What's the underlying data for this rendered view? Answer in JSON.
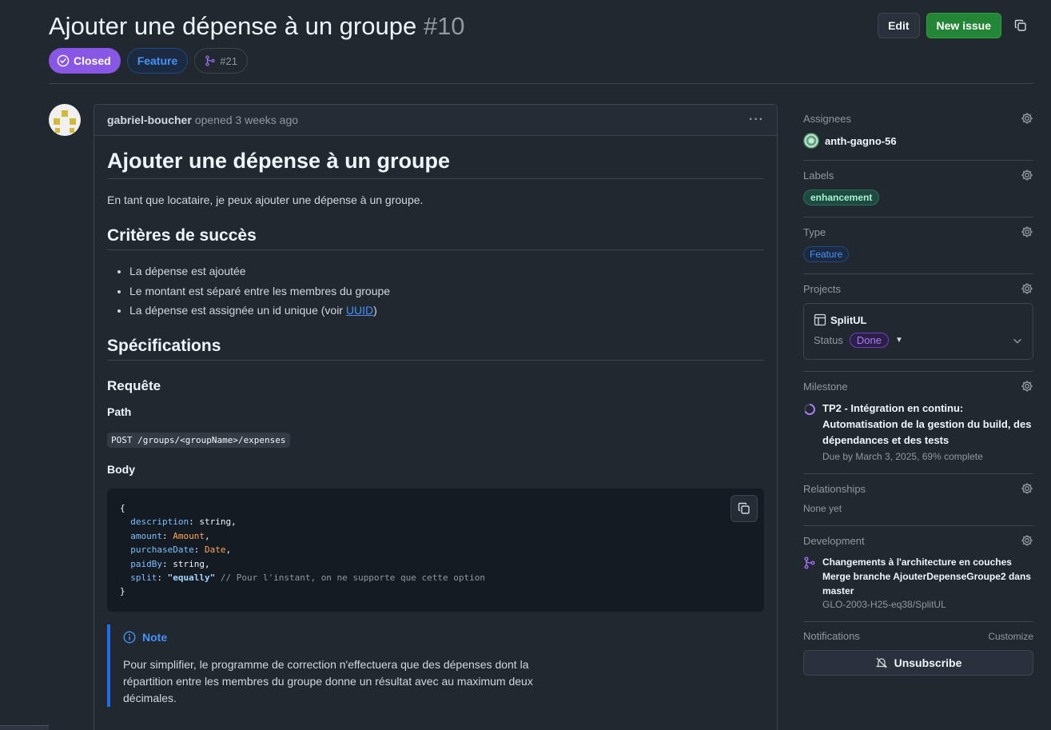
{
  "header": {
    "title": "Ajouter une dépense à un groupe",
    "number": "#10",
    "edit_label": "Edit",
    "new_issue_label": "New issue",
    "state": "Closed",
    "type": "Feature",
    "linked_pr": "#21"
  },
  "comment": {
    "author": "gabriel-boucher",
    "action": "opened 3 weeks ago",
    "heading": "Ajouter une dépense à un groupe",
    "intro": "En tant que locataire, je peux ajouter une dépense à un groupe.",
    "criteria_heading": "Critères de succès",
    "criteria": [
      "La dépense est ajoutée",
      "Le montant est séparé entre les membres du groupe"
    ],
    "criteria_last_prefix": "La dépense est assignée un id unique (voir ",
    "criteria_last_link": "UUID",
    "criteria_last_suffix": ")",
    "spec_heading": "Spécifications",
    "request_heading": "Requête",
    "path_heading": "Path",
    "path_code": "POST /groups/<groupName>/expenses",
    "body_heading": "Body",
    "code": {
      "open": "{",
      "close": "}",
      "lines": [
        {
          "prop": "description",
          "sep": ": ",
          "val": "string",
          "val_kind": "plain",
          "end": ","
        },
        {
          "prop": "amount",
          "sep": ": ",
          "val": "Amount",
          "val_kind": "type",
          "end": ","
        },
        {
          "prop": "purchaseDate",
          "sep": ": ",
          "val": "Date",
          "val_kind": "type",
          "end": ","
        },
        {
          "prop": "paidBy",
          "sep": ": ",
          "val": "string",
          "val_kind": "plain",
          "end": ","
        },
        {
          "prop": "split",
          "sep": ": ",
          "val": "\"equally\"",
          "val_kind": "str",
          "end": " ",
          "comment": "// Pour l'instant, on ne supporte que cette option"
        }
      ]
    },
    "note_title": "Note",
    "note_text": "Pour simplifier, le programme de correction n'effectuera que des dépenses dont la répartition entre les membres du groupe donne un résultat avec au maximum deux décimales."
  },
  "sidebar": {
    "assignees_label": "Assignees",
    "assignee": "anth-gagno-56",
    "labels_label": "Labels",
    "label": "enhancement",
    "type_label": "Type",
    "type_value": "Feature",
    "projects_label": "Projects",
    "project_name": "SplitUL",
    "status_label": "Status",
    "status_value": "Done",
    "milestone_label": "Milestone",
    "milestone_title": "TP2 - Intégration en continu: Automatisation de la gestion du build, des dépendances et des tests",
    "milestone_due": "Due by March 3, 2025, 69% complete",
    "relationships_label": "Relationships",
    "relationships_value": "None yet",
    "development_label": "Development",
    "dev_title": "Changements à l'architecture en couches Merge branche AjouterDepenseGroupe2 dans master",
    "dev_repo": "GLO-2003-H25-eq38/SplitUL",
    "notifications_label": "Notifications",
    "customize_label": "Customize",
    "unsubscribe_label": "Unsubscribe"
  },
  "colors": {
    "background": "#212830",
    "closed": "#8957e5",
    "primary": "#238636",
    "accent": "#4493f8"
  }
}
